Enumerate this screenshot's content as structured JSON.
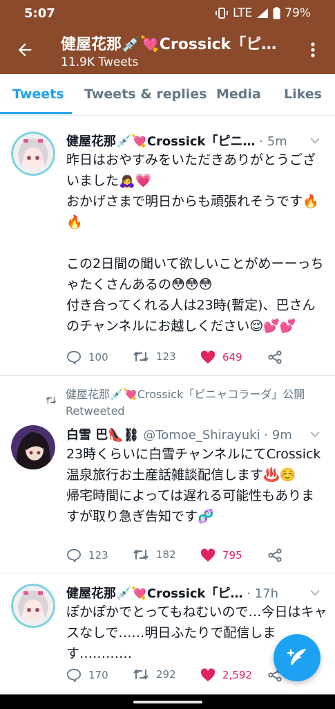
{
  "status_bar": {
    "time": "5:07",
    "network": "LTE",
    "battery": "79%"
  },
  "header": {
    "title": "健屋花那💉💘Crossick「ピ…",
    "tweet_count": "11.9K Tweets",
    "bg_color": "#8b4a2b"
  },
  "tabs": [
    {
      "label": "Tweets",
      "active": true
    },
    {
      "label": "Tweets & replies",
      "active": false
    },
    {
      "label": "Media",
      "active": false
    },
    {
      "label": "Likes",
      "active": false
    }
  ],
  "tweets": [
    {
      "name": "健屋花那💉💘Crossick「ピニ…",
      "meta": "· 5m",
      "text": "昨日はおやすみをいただきありがとうございました🙇‍♀️💗\nおかげさまで明日からも頑張れそうです🔥🔥\n\nこの2日間の聞いて欲しいことがめーーっちゃたくさんあるの😳😳😳\n付き合ってくれる人は23時(暫定)、巴さんのチャンネルにお越しください😌💕💕",
      "replies": "100",
      "retweets": "123",
      "likes": "649"
    },
    {
      "retweet_note": "健屋花那💉💘Crossick「ピニャコラーダ」公開 Retweeted",
      "name": "白雪 巴👠⛓",
      "meta": "@Tomoe_Shirayuki · 9m",
      "text": "23時くらいに白雪チャンネルにてCrossick温泉旅行お土産話雑談配信します♨️☺️\n帰宅時間によっては遅れる可能性もありますが取り急ぎ告知です🧬",
      "replies": "123",
      "retweets": "182",
      "likes": "795"
    },
    {
      "name": "健屋花那💉💘Crossick「ピ…",
      "meta": "· 17h",
      "text": "ぽかぽかでとってもねむいので…今日はキャスなしで……明日ふたりで配信します…………",
      "replies": "170",
      "retweets": "292",
      "likes": "2,592"
    }
  ],
  "colors": {
    "accent": "#1da1f2",
    "like": "#e0245e",
    "muted": "#657786"
  }
}
